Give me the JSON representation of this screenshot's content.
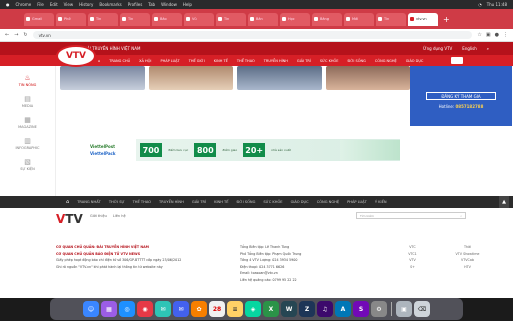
{
  "menubar": {
    "app": "Chrome",
    "items": [
      "File",
      "Edit",
      "View",
      "History",
      "Bookmarks",
      "Profiles",
      "Tab",
      "Window",
      "Help"
    ],
    "right": "Thu 11:48"
  },
  "tabs": [
    {
      "label": "Gmail"
    },
    {
      "label": "Phở"
    },
    {
      "label": "Tin"
    },
    {
      "label": "Tin"
    },
    {
      "label": "Bảo"
    },
    {
      "label": "Vũ"
    },
    {
      "label": "Tin"
    },
    {
      "label": "Bản"
    },
    {
      "label": "Học"
    },
    {
      "label": "Bảng"
    },
    {
      "label": "Mới"
    },
    {
      "label": "Tin"
    },
    {
      "label": "BĐ"
    },
    {
      "label": "Tin"
    },
    {
      "label": "Vũ"
    },
    {
      "label": "vtv.vn",
      "active": true
    }
  ],
  "address": {
    "url": "vtv.vn"
  },
  "site": {
    "logo": "VTV",
    "topstrip": [
      "ĐÀI TRUYỀN HÌNH VIỆT NAM"
    ],
    "topstrip_right": [
      "Ứng dụng VTV",
      "English"
    ],
    "nav": [
      "TRANG CHỦ",
      "XÃ HỘI",
      "PHÁP LUẬT",
      "THẾ GIỚI",
      "KINH TẾ",
      "THỂ THAO",
      "TRUYỀN HÌNH",
      "GIẢI TRÍ",
      "SỨC KHỎE",
      "ĐỜI SỐNG",
      "CÔNG NGHỆ",
      "GIÁO DỤC"
    ],
    "sidebar": [
      {
        "label": "TIN NÓNG",
        "icon": "fire-icon",
        "active": true
      },
      {
        "label": "MEDIA",
        "icon": "media-icon"
      },
      {
        "label": "MAGAZINE",
        "icon": "magazine-icon"
      },
      {
        "label": "INFOGRAPHIC",
        "icon": "infographic-icon"
      },
      {
        "label": "SỰ KIỆN",
        "icon": "event-icon"
      }
    ],
    "register": {
      "button": "ĐĂNG KÝ THAM GIA",
      "hotline_label": "Hotline:",
      "hotline": "0857182788"
    },
    "brand": {
      "top": "ViettelPost",
      "bottom": "ViettelPack"
    },
    "ads": [
      {
        "value": "700",
        "sub": "điểm bưu cục"
      },
      {
        "value": "800",
        "sub": "điểm giao"
      },
      {
        "value": "20+",
        "sub": "nhà sản xuất"
      }
    ]
  },
  "webnav": {
    "items": [
      "TRANG NHẤT",
      "THỜI SỰ",
      "THẾ THAO",
      "TRUYỀN HÌNH",
      "GIẢI TRÍ",
      "KINH TẾ",
      "ĐỜI SỐNG",
      "SỨC KHỎE",
      "GIÁO DỤC",
      "CÔNG NGHỆ",
      "PHÁP LUẬT",
      "Ý KIẾN"
    ]
  },
  "footer": {
    "nav": [
      "Giới thiệu",
      "Liên hệ"
    ],
    "search_placeholder": "Tìm kiếm",
    "col1": [
      {
        "text": "CƠ QUAN CHỦ QUẢN: ĐÀI TRUYỀN HÌNH VIỆT NAM",
        "red": true
      },
      {
        "text": "CƠ QUAN CHỦ QUẢN BÁO ĐIỆN TỬ VTV NEWS",
        "red": true
      },
      {
        "text": "Giấy phép hoạt động báo chí điện tử số 306/GP-BTTTT cấp ngày 23/06/2012"
      },
      {
        "text": "Ghi rõ nguồn \"VTV.vn\" khi phát hành lại thông tin từ website này"
      }
    ],
    "col2": [
      {
        "text": "Tổng Biên tập: Lê Thanh Tùng"
      },
      {
        "text": "Phó Tổng Biên tập: Phạm Quốc Trung"
      },
      {
        "text": "Tầng 4 VTV Lượng: 024 3934 5900"
      },
      {
        "text": "Điện thoại: 024 3771 6626"
      },
      {
        "text": "Email: toasoan@vtv.vn"
      },
      {
        "text": "Liên hệ quảng cáo: 0799 95 22 22"
      }
    ],
    "col3": [
      "VTC",
      "Thời",
      "VTC1",
      "VTV Showtime",
      "VTV",
      "VTVCab",
      "S+",
      "HTV"
    ]
  }
}
